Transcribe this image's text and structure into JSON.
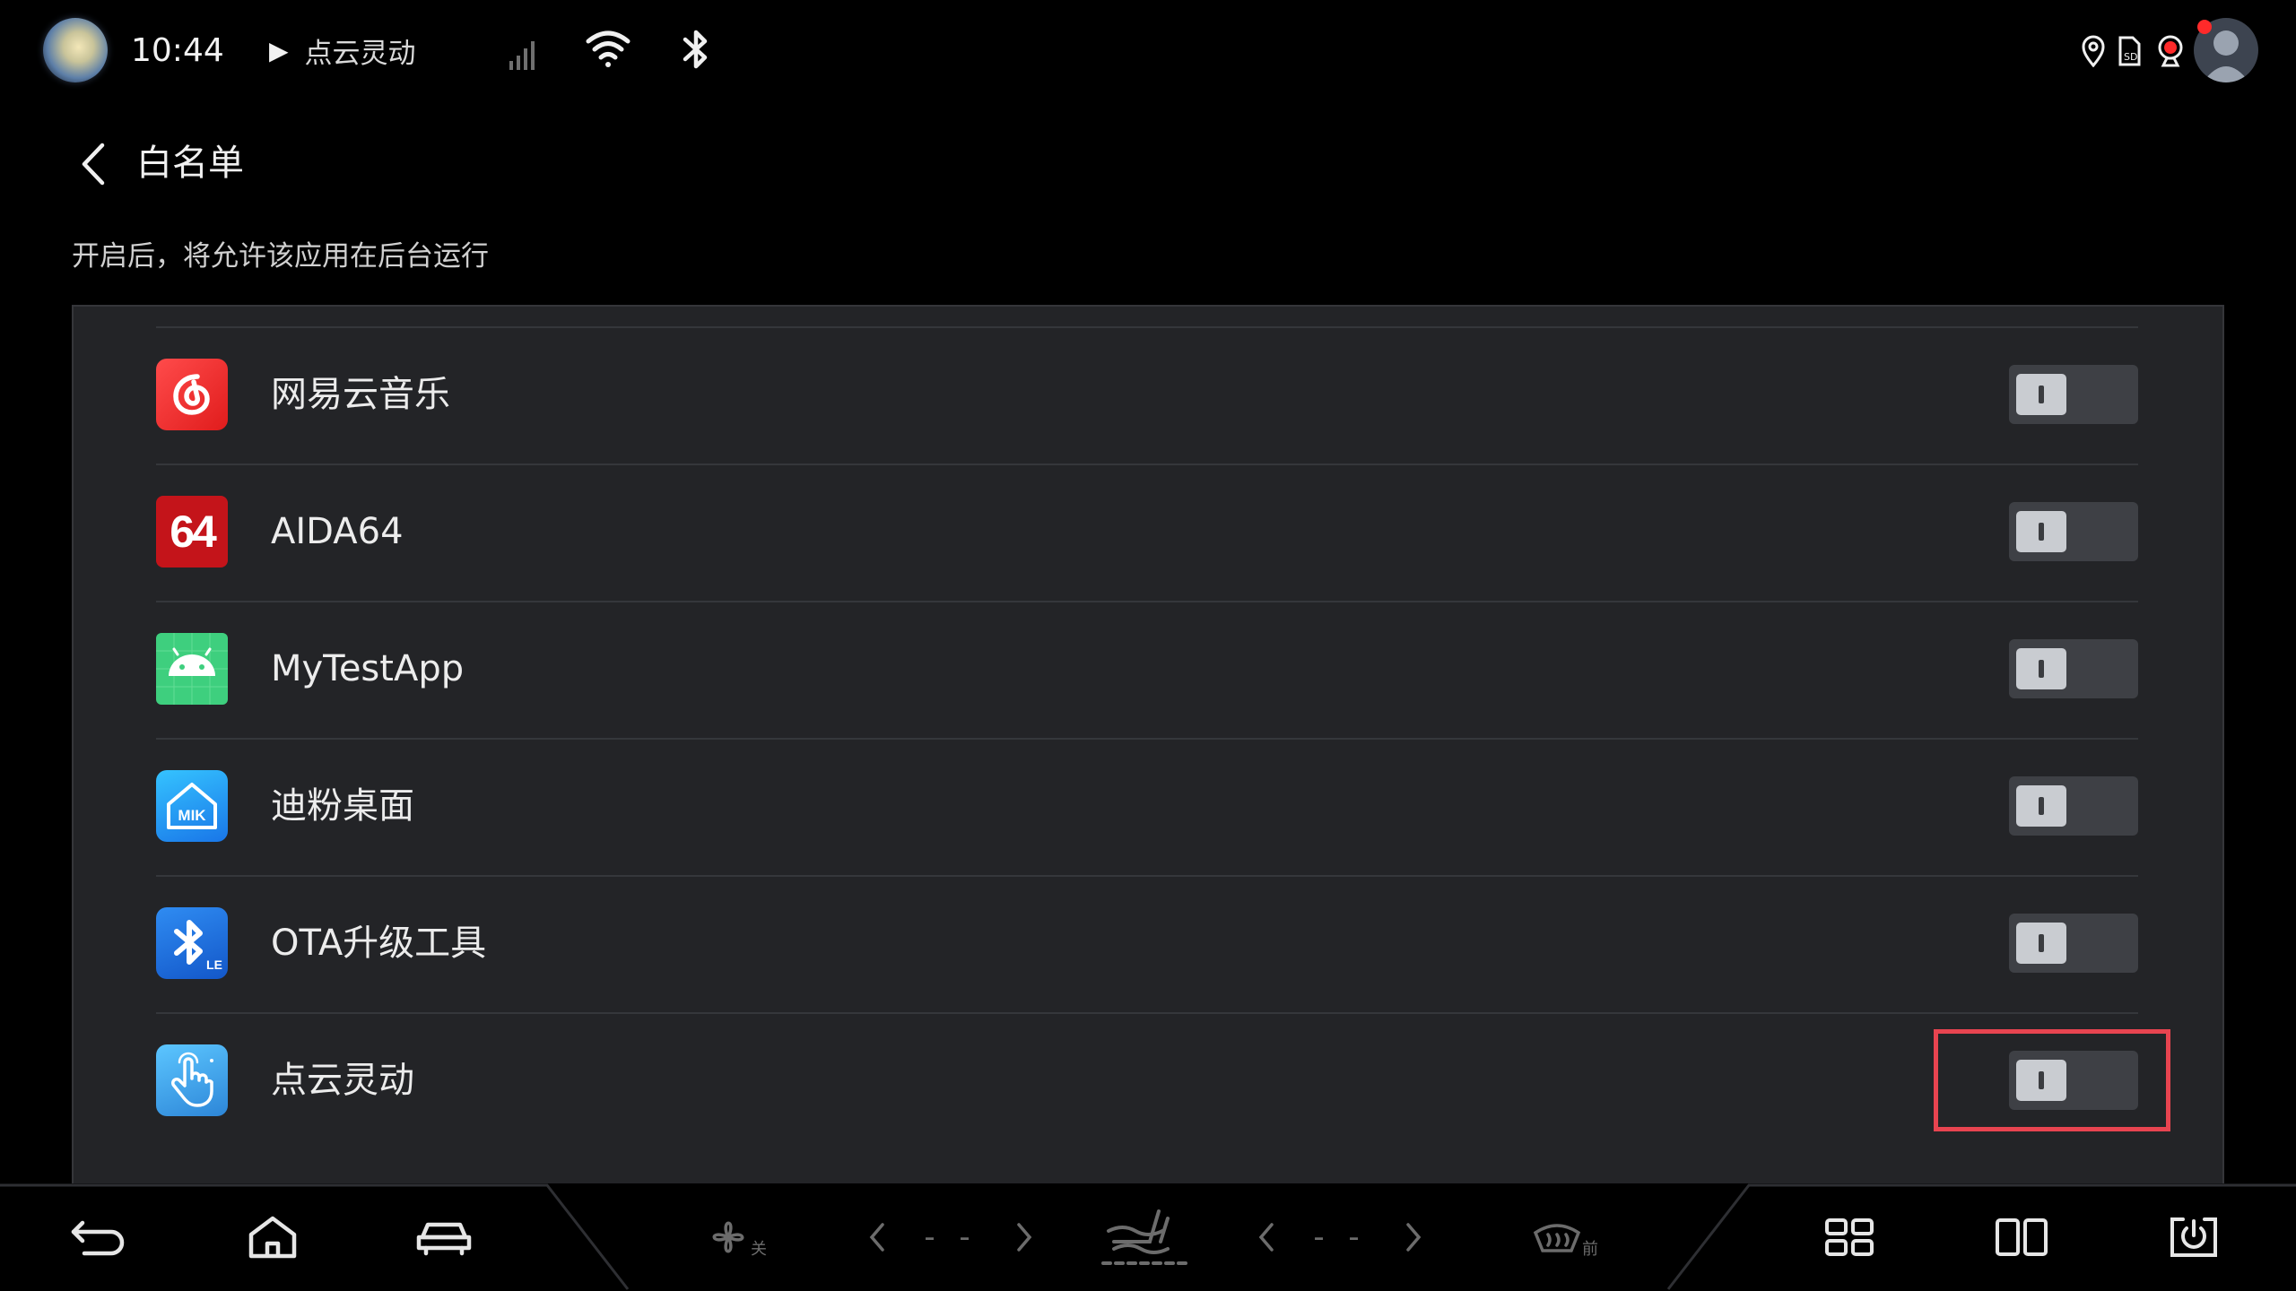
{
  "status_bar": {
    "time": "10:44",
    "media_play_icon": "play-icon",
    "media_title": "点云灵动",
    "icons": [
      "signal-icon",
      "wifi-icon",
      "bluetooth-icon",
      "location-icon",
      "sd-card-icon",
      "camera-icon"
    ]
  },
  "header": {
    "back_icon": "chevron-left-icon",
    "title": "白名单",
    "subtitle": "开启后，将允许该应用在后台运行"
  },
  "apps": [
    {
      "name": "网易云音乐",
      "icon": "netease-music-icon",
      "enabled": false
    },
    {
      "name": "AIDA64",
      "icon": "aida64-icon",
      "icon_text": "64",
      "enabled": false
    },
    {
      "name": "MyTestApp",
      "icon": "android-icon",
      "enabled": false
    },
    {
      "name": "迪粉桌面",
      "icon": "dfan-launcher-icon",
      "icon_text": "MIK",
      "enabled": false
    },
    {
      "name": "OTA升级工具",
      "icon": "bluetooth-le-icon",
      "icon_text": "LE",
      "enabled": false
    },
    {
      "name": "点云灵动",
      "icon": "touch-hand-icon",
      "enabled": false,
      "highlighted": true
    }
  ],
  "bottom_nav": {
    "fan_label": "关",
    "temp_left": "- -",
    "temp_right": "- -",
    "defrost_label": "前",
    "icons": [
      "back-icon",
      "home-icon",
      "car-icon",
      "fan-icon",
      "seat-heat-icon",
      "defrost-icon",
      "apps-grid-icon",
      "split-screen-icon",
      "power-icon"
    ]
  },
  "colors": {
    "background": "#000000",
    "panel": "#232427",
    "toggle_off": "#3e4045",
    "highlight": "#e84450"
  }
}
